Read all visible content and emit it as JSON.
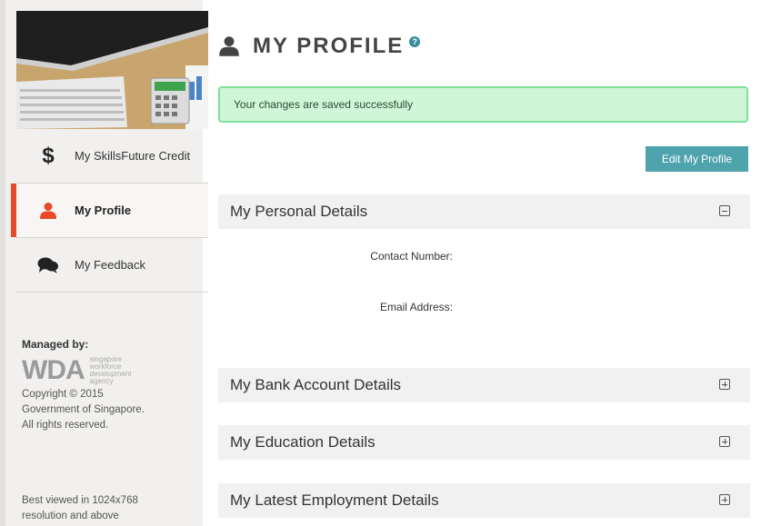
{
  "sidebar": {
    "items": [
      {
        "icon": "dollar-icon",
        "label": "My SkillsFuture Credit"
      },
      {
        "icon": "user-icon",
        "label": "My Profile"
      },
      {
        "icon": "chat-bubbles-icon",
        "label": "My Feedback"
      }
    ],
    "managed_title": "Managed by:",
    "wda_mark": "WDA",
    "wda_sub": [
      "singapore",
      "workforce",
      "development",
      "agency"
    ],
    "copyright": [
      "Copyright © 2015",
      "Government of Singapore.",
      "All rights reserved."
    ],
    "best_viewed": [
      "Best viewed in 1024x768",
      "resolution and above"
    ]
  },
  "main": {
    "title": "MY PROFILE",
    "help_glyph": "?",
    "alert": "Your changes are saved successfully",
    "edit_button": "Edit My Profile",
    "sections": [
      {
        "title": "My Personal Details",
        "state": "expanded"
      },
      {
        "title": "My Bank Account Details",
        "state": "collapsed"
      },
      {
        "title": "My Education Details",
        "state": "collapsed"
      },
      {
        "title": "My Latest Employment Details",
        "state": "collapsed"
      }
    ],
    "personal_fields": {
      "contact_label": "Contact Number:",
      "email_label": "Email Address:"
    }
  },
  "colors": {
    "accent": "#e8492b",
    "button": "#4fa3ad",
    "alert_bg": "#cff6d8",
    "alert_border": "#7ee196"
  }
}
